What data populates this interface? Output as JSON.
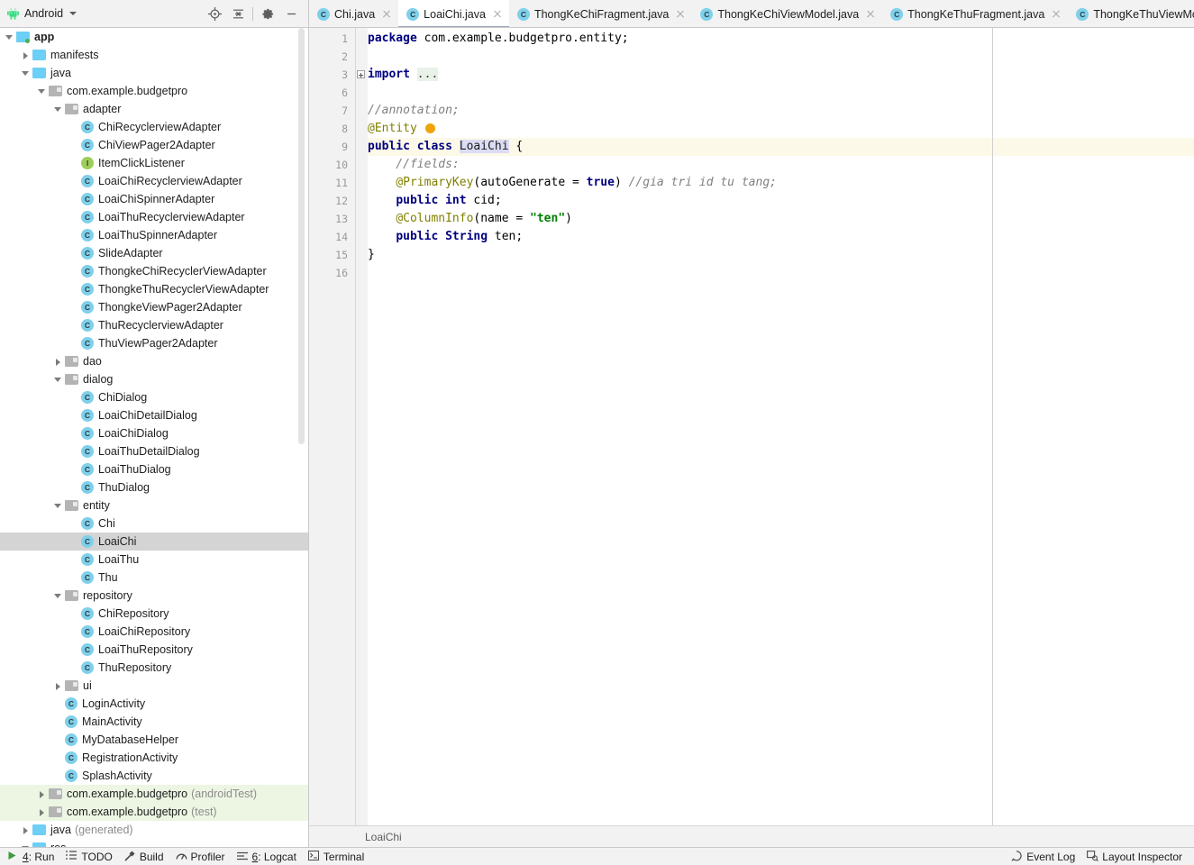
{
  "project_panel": {
    "title": "Android",
    "app_icon": "android-robot-icon",
    "dropdown_icon": "chevron-down-icon",
    "tools": [
      {
        "name": "select-opened-file-icon",
        "label": "Select Opened File"
      },
      {
        "name": "collapse-all-icon",
        "label": "Collapse All"
      },
      {
        "name": "gear-icon",
        "label": "Settings"
      },
      {
        "name": "minimize-icon",
        "label": "Hide"
      }
    ]
  },
  "tabs": {
    "items": [
      {
        "label": "Chi.java",
        "icon": "java-class-icon",
        "active": false
      },
      {
        "label": "LoaiChi.java",
        "icon": "java-class-icon",
        "active": true
      },
      {
        "label": "ThongKeChiFragment.java",
        "icon": "java-class-icon",
        "active": false
      },
      {
        "label": "ThongKeChiViewModel.java",
        "icon": "java-class-icon",
        "active": false
      },
      {
        "label": "ThongKeThuFragment.java",
        "icon": "java-class-icon",
        "active": false
      },
      {
        "label": "ThongKeThuViewModel.",
        "icon": "java-class-icon",
        "active": false
      }
    ],
    "close_icon": "close-icon",
    "list_icon": "tab-list-icon"
  },
  "tree": {
    "nodes": [
      {
        "indent": 0,
        "arrow": "down",
        "icon": "folder-blue-module",
        "label": "app",
        "bold": true
      },
      {
        "indent": 1,
        "arrow": "right",
        "icon": "folder-blue",
        "label": "manifests"
      },
      {
        "indent": 1,
        "arrow": "down",
        "icon": "folder-blue",
        "label": "java"
      },
      {
        "indent": 2,
        "arrow": "down",
        "icon": "folder-gray",
        "label": "com.example.budgetpro"
      },
      {
        "indent": 3,
        "arrow": "down",
        "icon": "folder-gray",
        "label": "adapter"
      },
      {
        "indent": 4,
        "arrow": "none",
        "icon": "class-icon",
        "label": "ChiRecyclerviewAdapter"
      },
      {
        "indent": 4,
        "arrow": "none",
        "icon": "class-icon",
        "label": "ChiViewPager2Adapter"
      },
      {
        "indent": 4,
        "arrow": "none",
        "icon": "interface-icon",
        "label": "ItemClickListener"
      },
      {
        "indent": 4,
        "arrow": "none",
        "icon": "class-icon",
        "label": "LoaiChiRecyclerviewAdapter"
      },
      {
        "indent": 4,
        "arrow": "none",
        "icon": "class-icon",
        "label": "LoaiChiSpinnerAdapter"
      },
      {
        "indent": 4,
        "arrow": "none",
        "icon": "class-icon",
        "label": "LoaiThuRecyclerviewAdapter"
      },
      {
        "indent": 4,
        "arrow": "none",
        "icon": "class-icon",
        "label": "LoaiThuSpinnerAdapter"
      },
      {
        "indent": 4,
        "arrow": "none",
        "icon": "class-icon",
        "label": "SlideAdapter"
      },
      {
        "indent": 4,
        "arrow": "none",
        "icon": "class-icon",
        "label": "ThongkeChiRecyclerViewAdapter"
      },
      {
        "indent": 4,
        "arrow": "none",
        "icon": "class-icon",
        "label": "ThongkeThuRecyclerViewAdapter"
      },
      {
        "indent": 4,
        "arrow": "none",
        "icon": "class-icon",
        "label": "ThongkeViewPager2Adapter"
      },
      {
        "indent": 4,
        "arrow": "none",
        "icon": "class-icon",
        "label": "ThuRecyclerviewAdapter"
      },
      {
        "indent": 4,
        "arrow": "none",
        "icon": "class-icon",
        "label": "ThuViewPager2Adapter"
      },
      {
        "indent": 3,
        "arrow": "right",
        "icon": "folder-gray",
        "label": "dao"
      },
      {
        "indent": 3,
        "arrow": "down",
        "icon": "folder-gray",
        "label": "dialog"
      },
      {
        "indent": 4,
        "arrow": "none",
        "icon": "class-icon",
        "label": "ChiDialog"
      },
      {
        "indent": 4,
        "arrow": "none",
        "icon": "class-icon",
        "label": "LoaiChiDetailDialog"
      },
      {
        "indent": 4,
        "arrow": "none",
        "icon": "class-icon",
        "label": "LoaiChiDialog"
      },
      {
        "indent": 4,
        "arrow": "none",
        "icon": "class-icon",
        "label": "LoaiThuDetailDialog"
      },
      {
        "indent": 4,
        "arrow": "none",
        "icon": "class-icon",
        "label": "LoaiThuDialog"
      },
      {
        "indent": 4,
        "arrow": "none",
        "icon": "class-icon",
        "label": "ThuDialog"
      },
      {
        "indent": 3,
        "arrow": "down",
        "icon": "folder-gray",
        "label": "entity"
      },
      {
        "indent": 4,
        "arrow": "none",
        "icon": "class-icon",
        "label": "Chi"
      },
      {
        "indent": 4,
        "arrow": "none",
        "icon": "class-icon",
        "label": "LoaiChi",
        "selected": true
      },
      {
        "indent": 4,
        "arrow": "none",
        "icon": "class-icon",
        "label": "LoaiThu"
      },
      {
        "indent": 4,
        "arrow": "none",
        "icon": "class-icon",
        "label": "Thu"
      },
      {
        "indent": 3,
        "arrow": "down",
        "icon": "folder-gray",
        "label": "repository"
      },
      {
        "indent": 4,
        "arrow": "none",
        "icon": "class-icon",
        "label": "ChiRepository"
      },
      {
        "indent": 4,
        "arrow": "none",
        "icon": "class-icon",
        "label": "LoaiChiRepository"
      },
      {
        "indent": 4,
        "arrow": "none",
        "icon": "class-icon",
        "label": "LoaiThuRepository"
      },
      {
        "indent": 4,
        "arrow": "none",
        "icon": "class-icon",
        "label": "ThuRepository"
      },
      {
        "indent": 3,
        "arrow": "right",
        "icon": "folder-gray",
        "label": "ui"
      },
      {
        "indent": 3,
        "arrow": "none",
        "icon": "class-icon",
        "label": "LoginActivity"
      },
      {
        "indent": 3,
        "arrow": "none",
        "icon": "class-icon",
        "label": "MainActivity"
      },
      {
        "indent": 3,
        "arrow": "none",
        "icon": "class-icon",
        "label": "MyDatabaseHelper"
      },
      {
        "indent": 3,
        "arrow": "none",
        "icon": "class-icon",
        "label": "RegistrationActivity"
      },
      {
        "indent": 3,
        "arrow": "none",
        "icon": "class-icon",
        "label": "SplashActivity"
      },
      {
        "indent": 2,
        "arrow": "right",
        "icon": "folder-gray",
        "label": "com.example.budgetpro",
        "suffix": "(androidTest)",
        "testsrc": true
      },
      {
        "indent": 2,
        "arrow": "right",
        "icon": "folder-gray",
        "label": "com.example.budgetpro",
        "suffix": "(test)",
        "testsrc": true
      },
      {
        "indent": 1,
        "arrow": "right",
        "icon": "folder-blue-gen",
        "label": "java",
        "suffix": "(generated)"
      },
      {
        "indent": 1,
        "arrow": "down",
        "icon": "folder-blue",
        "label": "res"
      }
    ]
  },
  "editor": {
    "file": "LoaiChi.java",
    "breadcrumb": "LoaiChi",
    "highlighted_line": 9,
    "line_numbers": [
      1,
      2,
      3,
      6,
      7,
      8,
      9,
      10,
      11,
      12,
      13,
      14,
      15,
      16
    ],
    "lines": [
      {
        "num": 1,
        "tokens": [
          {
            "t": "package ",
            "c": "kw"
          },
          {
            "t": "com.example.budgetpro.entity;",
            "c": "plain"
          }
        ]
      },
      {
        "num": 2,
        "tokens": []
      },
      {
        "num": 3,
        "tokens": [
          {
            "t": "import ",
            "c": "kw"
          },
          {
            "t": "...",
            "c": "folded"
          }
        ],
        "fold": true
      },
      {
        "num": 6,
        "tokens": []
      },
      {
        "num": 7,
        "tokens": [
          {
            "t": "//annotation;",
            "c": "cmt"
          }
        ]
      },
      {
        "num": 8,
        "tokens": [
          {
            "t": "@Entity",
            "c": "anno"
          }
        ]
      },
      {
        "num": 9,
        "tokens": [
          {
            "t": "public class ",
            "c": "kw"
          },
          {
            "t": "LoaiChi",
            "c": "cname"
          },
          {
            "t": " {",
            "c": "plain"
          }
        ]
      },
      {
        "num": 10,
        "tokens": [
          {
            "t": "    //fields:",
            "c": "cmt"
          }
        ]
      },
      {
        "num": 11,
        "tokens": [
          {
            "t": "    ",
            "c": "plain"
          },
          {
            "t": "@PrimaryKey",
            "c": "anno"
          },
          {
            "t": "(autoGenerate = ",
            "c": "plain"
          },
          {
            "t": "true",
            "c": "kw"
          },
          {
            "t": ") ",
            "c": "plain"
          },
          {
            "t": "//gia tri id tu tang;",
            "c": "cmt"
          }
        ]
      },
      {
        "num": 12,
        "tokens": [
          {
            "t": "    ",
            "c": "plain"
          },
          {
            "t": "public int ",
            "c": "kw"
          },
          {
            "t": "cid;",
            "c": "plain"
          }
        ]
      },
      {
        "num": 13,
        "tokens": [
          {
            "t": "    ",
            "c": "plain"
          },
          {
            "t": "@ColumnInfo",
            "c": "anno"
          },
          {
            "t": "(name = ",
            "c": "plain"
          },
          {
            "t": "\"ten\"",
            "c": "str"
          },
          {
            "t": ")",
            "c": "plain"
          }
        ]
      },
      {
        "num": 14,
        "tokens": [
          {
            "t": "    ",
            "c": "plain"
          },
          {
            "t": "public String ",
            "c": "kw"
          },
          {
            "t": "ten;",
            "c": "plain"
          }
        ]
      },
      {
        "num": 15,
        "tokens": [
          {
            "t": "}",
            "c": "plain"
          }
        ]
      },
      {
        "num": 16,
        "tokens": []
      }
    ]
  },
  "statusbar": {
    "left": [
      {
        "label": "4: Run",
        "icon": "run-icon",
        "mnemonic": "4"
      },
      {
        "label": "TODO",
        "icon": "todo-list-icon",
        "mnemonic": ""
      },
      {
        "label": "Build",
        "icon": "hammer-icon",
        "mnemonic": ""
      },
      {
        "label": "Profiler",
        "icon": "profiler-icon",
        "mnemonic": ""
      },
      {
        "label": "6: Logcat",
        "icon": "logcat-icon",
        "mnemonic": "6"
      },
      {
        "label": "Terminal",
        "icon": "terminal-icon",
        "mnemonic": ""
      }
    ],
    "right": [
      {
        "label": "Event Log",
        "icon": "event-log-icon"
      },
      {
        "label": "Layout Inspector",
        "icon": "layout-inspector-icon"
      }
    ]
  },
  "colors": {
    "panel_bg": "#f2f2f2",
    "selection": "#d4d4d4",
    "test_source": "#edf6e3",
    "line_highlight": "#fcf9e8",
    "class_icon": "#7fd0ea",
    "interface_icon": "#9ece5a",
    "keyword": "#000080",
    "annotation": "#808000",
    "string": "#008000",
    "comment": "#808080"
  }
}
